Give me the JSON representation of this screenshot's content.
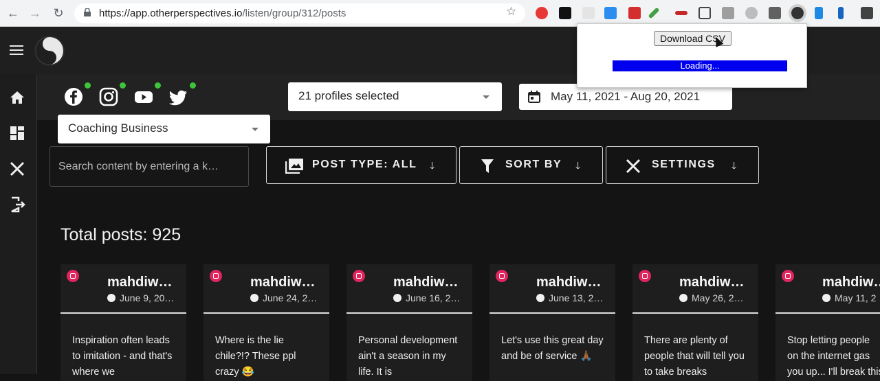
{
  "browser": {
    "url_host": "https://app.otherperspectives.io",
    "url_path": "/listen/group/312/posts"
  },
  "filters": {
    "profiles_label": "21 profiles selected",
    "date_range": "May 11, 2021 - Aug 20, 2021",
    "group_label": "Coaching Business",
    "social_networks": [
      "facebook",
      "instagram",
      "youtube",
      "twitter"
    ]
  },
  "toolbar": {
    "search_placeholder": "Search content by entering a k…",
    "post_type_label": "POST TYPE: ALL",
    "sort_label": "SORT BY",
    "settings_label": "SETTINGS"
  },
  "total_posts_label": "Total posts: 925",
  "posts": [
    {
      "author": "mahdiw…",
      "date": "June 9, 20…",
      "text": "Inspiration often leads to imitation - and that's where we"
    },
    {
      "author": "mahdiw…",
      "date": "June 24, 2…",
      "text": "Where is the lie chile?!? These ppl crazy 😂"
    },
    {
      "author": "mahdiw…",
      "date": "June 16, 2…",
      "text": "Personal development ain't a season in my life. It is"
    },
    {
      "author": "mahdiw…",
      "date": "June 13, 2…",
      "text": "Let's use this great day and be of service 🙏🏾"
    },
    {
      "author": "mahdiw…",
      "date": "May 26, 2…",
      "text": "There are plenty of people that will tell you to take breaks"
    },
    {
      "author": "mahdiw…",
      "date": "May 11, 2",
      "text": "Stop letting people on the internet gas you up... I'll break this"
    }
  ],
  "popup": {
    "download_label": "Download CSV",
    "loading_label": "Loading..."
  },
  "colors": {
    "accent_green": "#3ec43a",
    "instagram": "#e0245e",
    "loading_blue": "#0000ee"
  }
}
